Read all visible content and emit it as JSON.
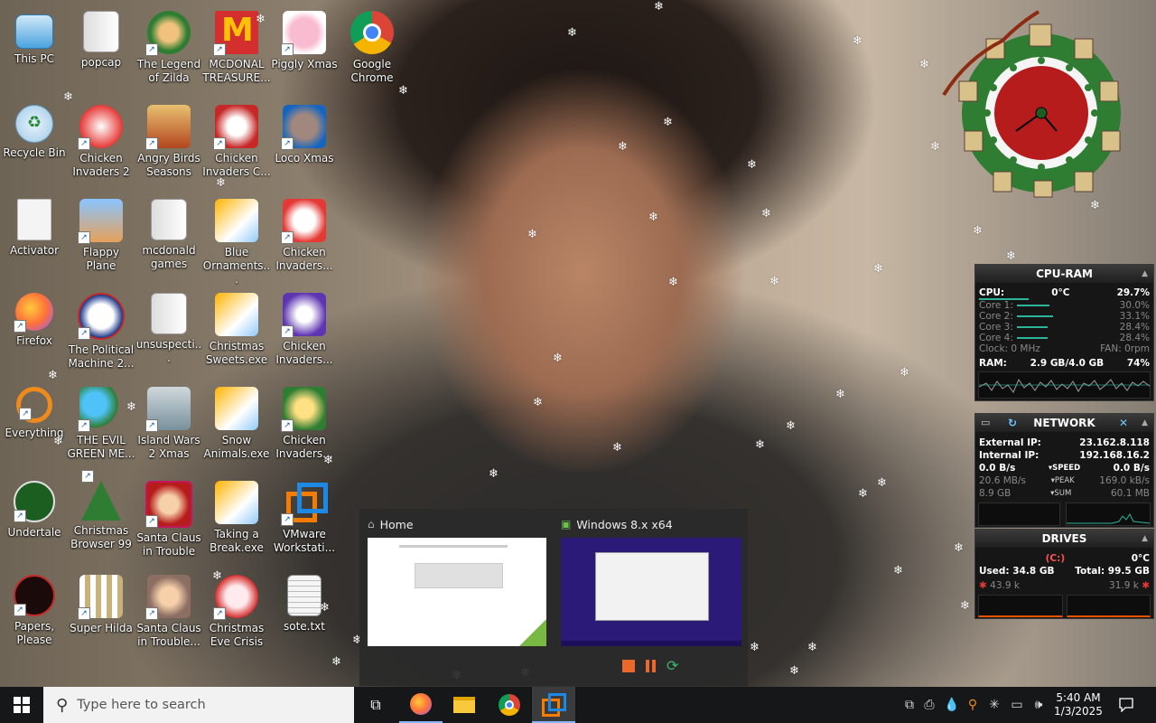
{
  "desktop": {
    "icons": [
      {
        "label": "This PC"
      },
      {
        "label": "popcap"
      },
      {
        "label": "The Legend of Zilda"
      },
      {
        "label": "MCDONAL TREASURE..."
      },
      {
        "label": "Piggly Xmas"
      },
      {
        "label": "Google Chrome"
      },
      {
        "label": "Recycle Bin"
      },
      {
        "label": "Chicken Invaders 2"
      },
      {
        "label": "Angry Birds Seasons"
      },
      {
        "label": "Chicken Invaders C..."
      },
      {
        "label": "Loco Xmas"
      },
      {
        "label": "Activator"
      },
      {
        "label": "Flappy Plane"
      },
      {
        "label": "mcdonald games"
      },
      {
        "label": "Blue Ornaments..."
      },
      {
        "label": "Chicken Invaders..."
      },
      {
        "label": "Firefox"
      },
      {
        "label": "The Political Machine 2..."
      },
      {
        "label": "unsuspecti..."
      },
      {
        "label": "Christmas Sweets.exe"
      },
      {
        "label": "Chicken Invaders..."
      },
      {
        "label": "Everything"
      },
      {
        "label": "THE EVIL GREEN ME..."
      },
      {
        "label": "Island Wars 2 Xmas"
      },
      {
        "label": "Snow Animals.exe"
      },
      {
        "label": "Chicken Invaders..."
      },
      {
        "label": "Undertale"
      },
      {
        "label": "Christmas Browser 99"
      },
      {
        "label": "Santa Claus in Trouble"
      },
      {
        "label": "Taking a Break.exe"
      },
      {
        "label": "VMware Workstati..."
      },
      {
        "label": "Papers, Please"
      },
      {
        "label": "Super Hilda"
      },
      {
        "label": "Santa Claus in Trouble..."
      },
      {
        "label": "Christmas Eve Crisis"
      },
      {
        "label": "sote.txt"
      }
    ]
  },
  "cpu_ram": {
    "title": "CPU-RAM",
    "cpu_label": "CPU:",
    "cpu_temp": "0°C",
    "cpu_pct": "29.7%",
    "cores": [
      {
        "label": "Core 1:",
        "value": "30.0%",
        "level": 0.3
      },
      {
        "label": "Core 2:",
        "value": "33.1%",
        "level": 0.33
      },
      {
        "label": "Core 3:",
        "value": "28.4%",
        "level": 0.28
      },
      {
        "label": "Core 4:",
        "value": "28.4%",
        "level": 0.28
      }
    ],
    "clock": "Clock: 0 MHz",
    "fan": "FAN: 0rpm",
    "ram_label": "RAM:",
    "ram_value": "2.9 GB/4.0 GB",
    "ram_pct": "74%"
  },
  "network": {
    "title": "NETWORK",
    "external_label": "External IP:",
    "external_ip": "23.162.8.118",
    "internal_label": "Internal IP:",
    "internal_ip": "192.168.16.2",
    "speed_down": "0.0 B/s",
    "speed_label": "SPEED",
    "speed_up": "0.0 B/s",
    "peak_down": "20.6 MB/s",
    "peak_label": "PEAK",
    "peak_up": "169.0 kB/s",
    "sum_down": "8.9 GB",
    "sum_label": "SUM",
    "sum_up": "60.1 MB"
  },
  "drives": {
    "title": "DRIVES",
    "drive": "(C:)",
    "temp": "0°C",
    "used": "Used: 34.8 GB",
    "total": "Total: 99.5 GB",
    "read": "43.9 k",
    "write": "31.9 k"
  },
  "taskview": {
    "cards": [
      {
        "title": "Home"
      },
      {
        "title": "Windows 8.x x64"
      }
    ]
  },
  "taskbar": {
    "search_placeholder": "Type here to search",
    "time": "5:40 AM",
    "date": "1/3/2025"
  },
  "colors": {
    "accent": "#2db59c",
    "taskbar": "#161718",
    "vm_purple": "#2b1a78"
  }
}
